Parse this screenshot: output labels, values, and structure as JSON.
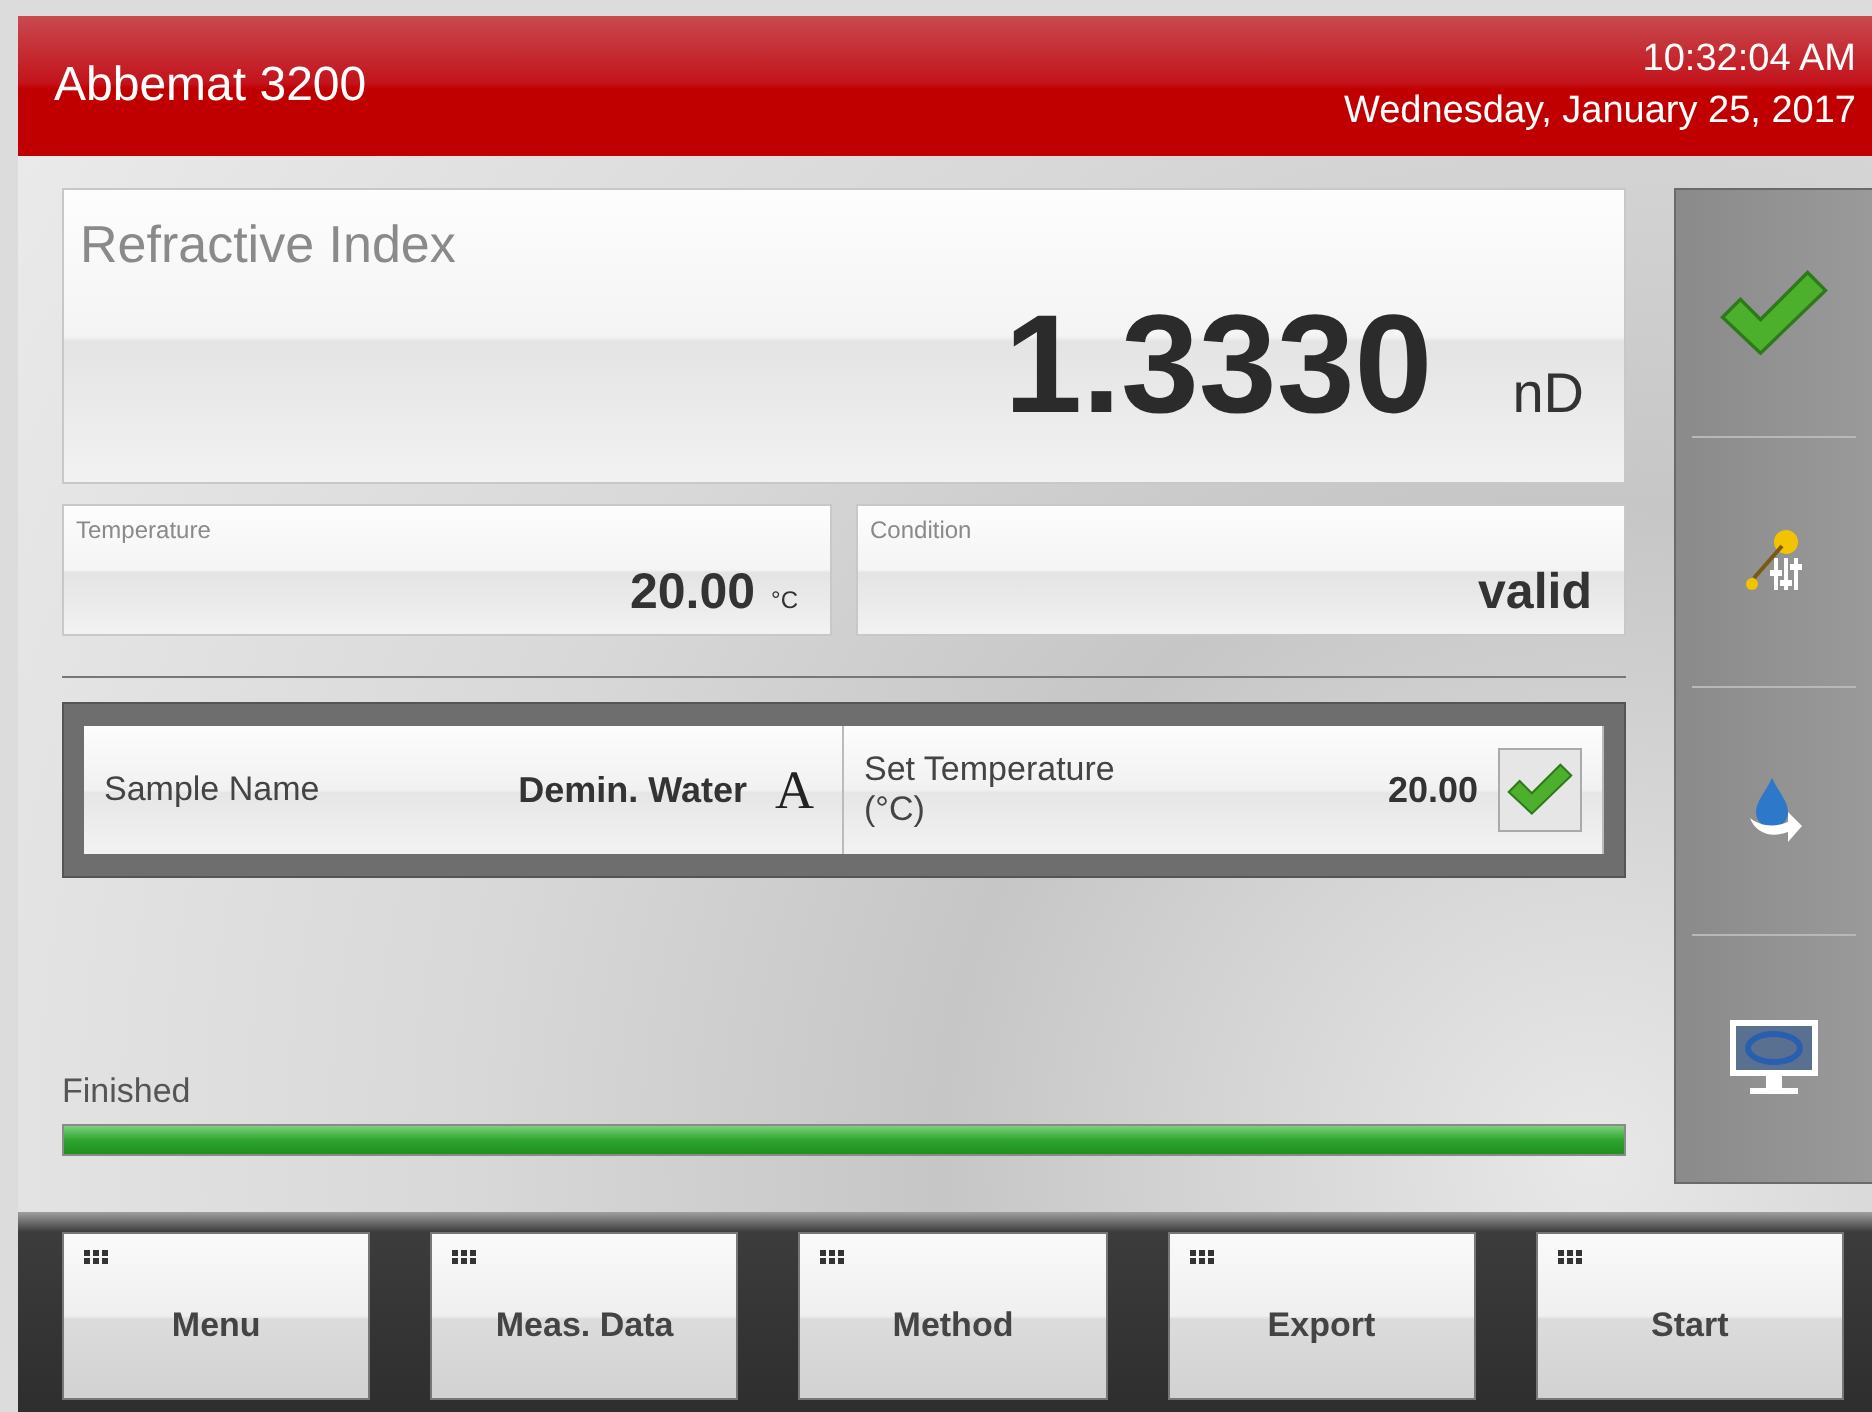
{
  "header": {
    "title": "Abbemat 3200",
    "time": "10:32:04 AM",
    "date": "Wednesday, January 25, 2017"
  },
  "result": {
    "label": "Refractive Index",
    "value": "1.3330",
    "unit": "nD"
  },
  "readings": [
    {
      "label": "Temperature",
      "value": "20.00",
      "unit": "°C"
    },
    {
      "label": "Condition",
      "value": "valid"
    }
  ],
  "parameters": {
    "sample_label": "Sample Name",
    "sample_value": "Demin. Water",
    "text_button": "A",
    "set_temp_label": "Set Temperature (°C)",
    "set_temp_value": "20.00",
    "set_temp_checked": true
  },
  "progress": {
    "label": "Finished",
    "level": 1.0
  },
  "side_buttons": [
    {
      "kind": "check"
    },
    {
      "kind": "adjust"
    },
    {
      "kind": "sample"
    },
    {
      "kind": "display"
    }
  ],
  "footer_buttons": [
    "Menu",
    "Meas. Data",
    "Method",
    "Export",
    "Start"
  ]
}
